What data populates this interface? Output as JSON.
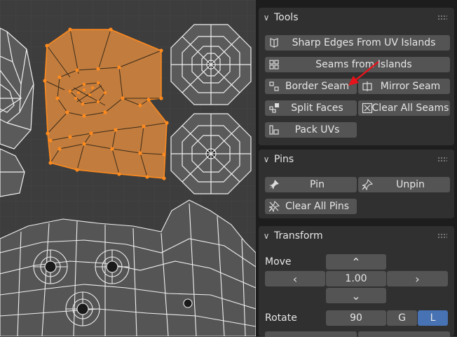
{
  "tools": {
    "title": "Tools",
    "sharp_edges": "Sharp Edges From UV Islands",
    "seams_from_islands": "Seams from Islands",
    "border_seam": "Border Seam",
    "mirror_seam": "Mirror Seam",
    "split_faces": "Split Faces",
    "clear_all_seams": "Clear All Seams",
    "pack_uvs": "Pack UVs"
  },
  "pins": {
    "title": "Pins",
    "pin": "Pin",
    "unpin": "Unpin",
    "clear_all_pins": "Clear All Pins"
  },
  "transform": {
    "title": "Transform",
    "move_label": "Move",
    "move_value": "1.00",
    "rotate_label": "Rotate",
    "rotate_value": "90",
    "global_label": "G",
    "local_label": "L"
  },
  "colors": {
    "selection_fill": "#c27d3e",
    "selection_vertex": "#ff8a1d",
    "accent_active": "#4772b3",
    "annotation_arrow": "#e8131a"
  }
}
